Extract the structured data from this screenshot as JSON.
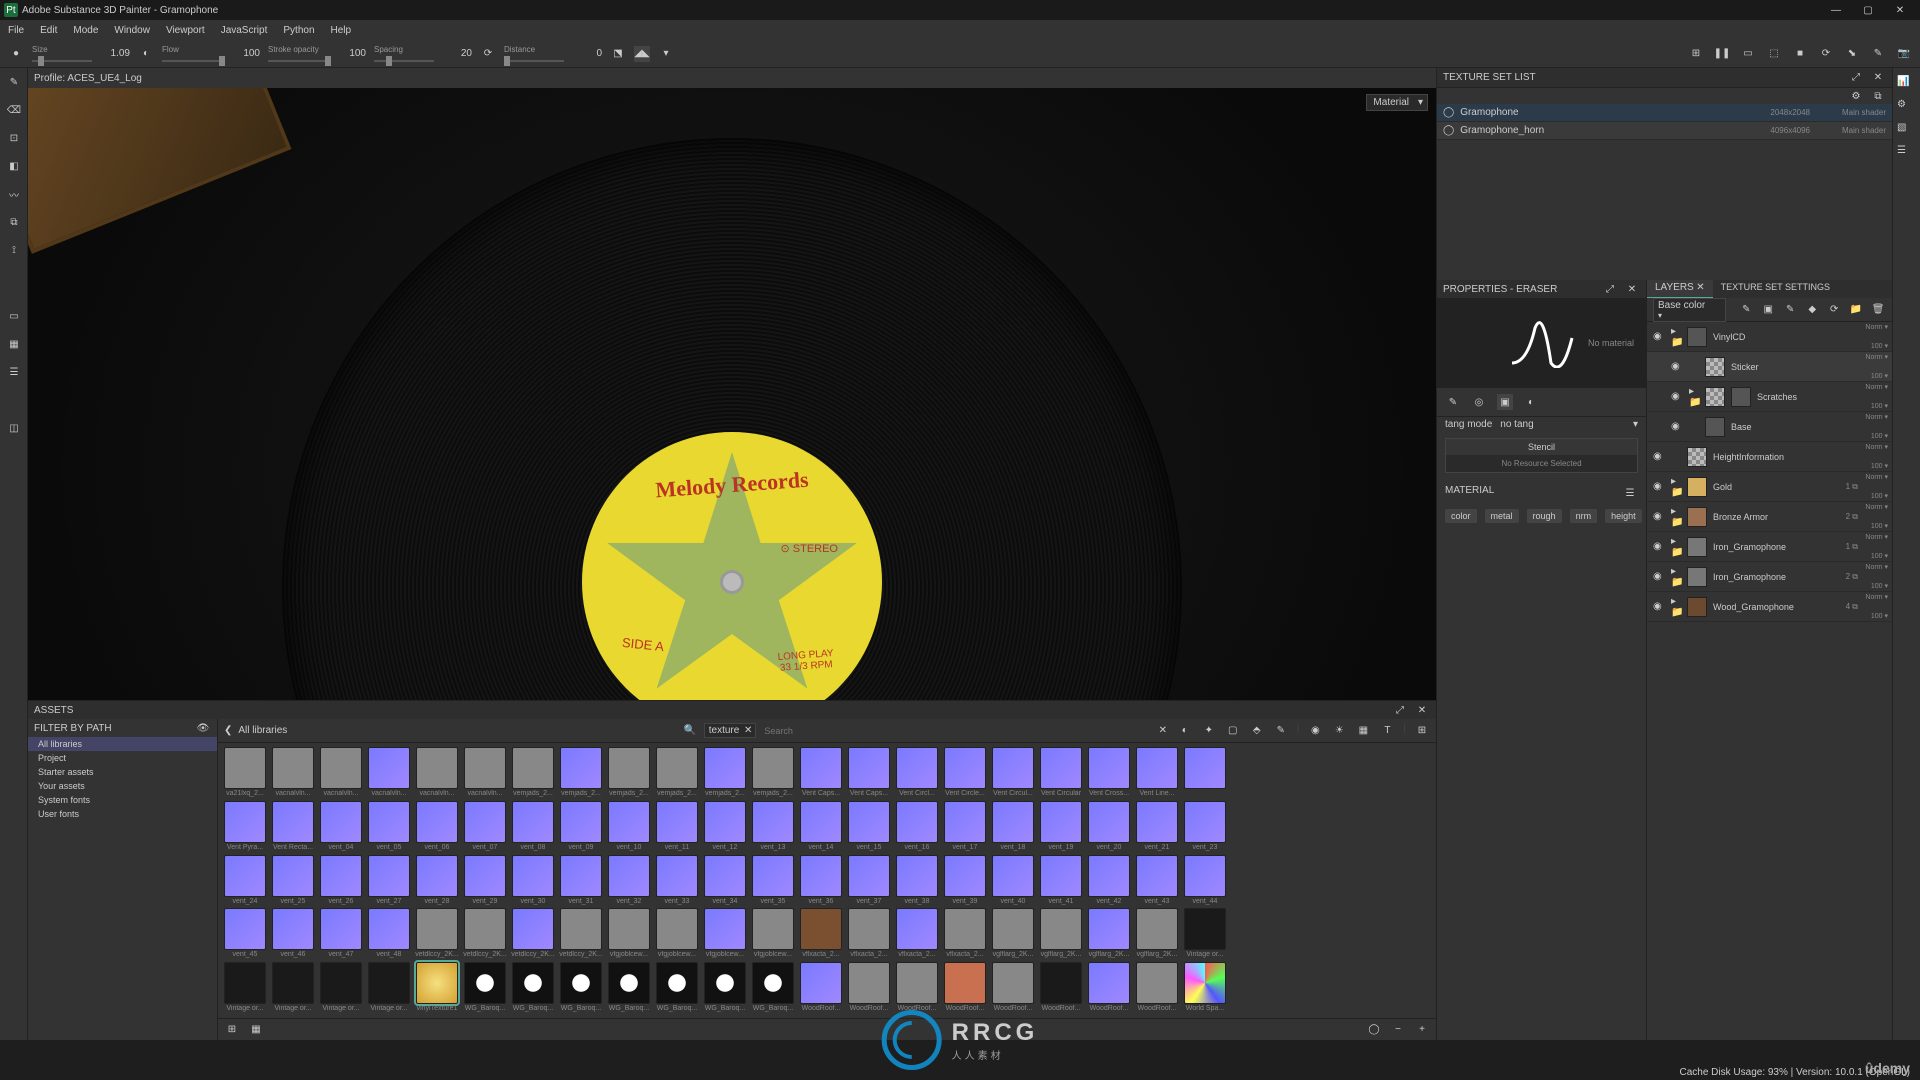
{
  "window": {
    "title": "Adobe Substance 3D Painter - Gramophone"
  },
  "menu": [
    "File",
    "Edit",
    "Mode",
    "Window",
    "Viewport",
    "JavaScript",
    "Python",
    "Help"
  ],
  "toolbar": {
    "size_label": "Size",
    "size_value": "1.09",
    "flow_label": "Flow",
    "flow_value": "100",
    "stroke_label": "Stroke opacity",
    "stroke_value": "100",
    "spacing_label": "Spacing",
    "spacing_value": "20",
    "distance_label": "Distance",
    "distance_value": "0"
  },
  "viewport": {
    "profile": "Profile: ACES_UE4_Log",
    "material_dropdown": "Material",
    "record": {
      "brand": "Melody Records",
      "stereo": "⊙ STEREO",
      "side": "SIDE A",
      "speed": "LONG PLAY\n33 1/3 RPM"
    }
  },
  "texture_set_list": {
    "title": "TEXTURE SET LIST",
    "rows": [
      {
        "name": "Gramophone",
        "res": "2048x2048",
        "shader": "Main shader",
        "selected": true
      },
      {
        "name": "Gramophone_horn",
        "res": "4096x4096",
        "shader": "Main shader",
        "selected": false
      }
    ]
  },
  "properties": {
    "title": "PROPERTIES - ERASER",
    "no_material": "No material",
    "tang_mode_l": "tang mode",
    "tang_mode_v": "no tang",
    "stencil_title": "Stencil",
    "stencil_body": "No Resource Selected",
    "material_title": "MATERIAL",
    "channels": [
      "color",
      "metal",
      "rough",
      "nrm",
      "height"
    ]
  },
  "layers": {
    "tab_layers": "LAYERS",
    "tab_tss": "TEXTURE SET SETTINGS",
    "mode_select": "Base color",
    "items": [
      {
        "name": "VinylCD",
        "thumb": "dark",
        "folder": true,
        "indent": 0,
        "selected": false,
        "blend": "Norm",
        "opacity": "100"
      },
      {
        "name": "Sticker",
        "thumb": "checker",
        "folder": false,
        "indent": 1,
        "selected": true,
        "blend": "Norm",
        "opacity": "100"
      },
      {
        "name": "Scratches",
        "thumb": "checker",
        "mask": true,
        "folder": true,
        "indent": 1,
        "selected": false,
        "blend": "Norm",
        "opacity": "100"
      },
      {
        "name": "Base",
        "thumb": "dark",
        "folder": false,
        "indent": 1,
        "selected": false,
        "blend": "Norm",
        "opacity": "100"
      },
      {
        "name": "HeightInformation",
        "thumb": "checker",
        "folder": false,
        "indent": 0,
        "selected": false,
        "blend": "Norm",
        "opacity": "100"
      },
      {
        "name": "Gold",
        "thumb": "gold",
        "folder": true,
        "indent": 0,
        "selected": false,
        "blend": "Norm",
        "opacity": "100",
        "link": "1"
      },
      {
        "name": "Bronze Armor",
        "thumb": "bronze",
        "folder": true,
        "indent": 0,
        "selected": false,
        "blend": "Norm",
        "opacity": "100",
        "link": "2"
      },
      {
        "name": "Iron_Gramophone",
        "thumb": "iron",
        "folder": true,
        "indent": 0,
        "selected": false,
        "blend": "Norm",
        "opacity": "100",
        "link": "1"
      },
      {
        "name": "Iron_Gramophone",
        "thumb": "iron",
        "folder": true,
        "indent": 0,
        "selected": false,
        "blend": "Norm",
        "opacity": "100",
        "link": "2"
      },
      {
        "name": "Wood_Gramophone",
        "thumb": "wood",
        "folder": true,
        "indent": 0,
        "selected": false,
        "blend": "Norm",
        "opacity": "100",
        "link": "4"
      }
    ]
  },
  "assets": {
    "title": "ASSETS",
    "filter_hdr": "FILTER BY PATH",
    "breadcrumb": "All libraries",
    "search_placeholder": "Search",
    "chip": "texture",
    "libs": [
      {
        "name": "All libraries",
        "selected": true
      },
      {
        "name": "Project"
      },
      {
        "name": "Starter assets"
      },
      {
        "name": "Your assets"
      },
      {
        "name": "System fonts"
      },
      {
        "name": "User fonts"
      }
    ],
    "grid": [
      {
        "t": "gray",
        "l": "va21lxq_2..."
      },
      {
        "t": "gray",
        "l": "vacnalvln..."
      },
      {
        "t": "gray",
        "l": "vacnalvln..."
      },
      {
        "t": "purple",
        "l": "vacnalvln..."
      },
      {
        "t": "gray",
        "l": "vacnalvln..."
      },
      {
        "t": "gray",
        "l": "vacnalvln..."
      },
      {
        "t": "gray",
        "l": "vemjads_2..."
      },
      {
        "t": "purple",
        "l": "vemjads_2..."
      },
      {
        "t": "gray",
        "l": "vemjads_2..."
      },
      {
        "t": "gray",
        "l": "vemjads_2..."
      },
      {
        "t": "purple",
        "l": "vemjads_2..."
      },
      {
        "t": "gray",
        "l": "vemjads_2..."
      },
      {
        "t": "purple",
        "l": "Vent Caps..."
      },
      {
        "t": "purple",
        "l": "Vent Caps..."
      },
      {
        "t": "purple",
        "l": "Vent Circl..."
      },
      {
        "t": "purple",
        "l": "Vent Circle..."
      },
      {
        "t": "purple",
        "l": "Vent Circul..."
      },
      {
        "t": "purple",
        "l": "Vent Circular"
      },
      {
        "t": "purple",
        "l": "Vent Cross..."
      },
      {
        "t": "purple",
        "l": "Vent Line..."
      },
      {
        "t": "purple",
        "l": ""
      },
      {
        "t": "purple",
        "l": "Vent Pyra..."
      },
      {
        "t": "purple",
        "l": "Vent Recta..."
      },
      {
        "t": "purple",
        "l": "vent_04"
      },
      {
        "t": "purple",
        "l": "vent_05"
      },
      {
        "t": "purple",
        "l": "vent_06"
      },
      {
        "t": "purple",
        "l": "vent_07"
      },
      {
        "t": "purple",
        "l": "vent_08"
      },
      {
        "t": "purple",
        "l": "vent_09"
      },
      {
        "t": "purple",
        "l": "vent_10"
      },
      {
        "t": "purple",
        "l": "vent_11"
      },
      {
        "t": "purple",
        "l": "vent_12"
      },
      {
        "t": "purple",
        "l": "vent_13"
      },
      {
        "t": "purple",
        "l": "vent_14"
      },
      {
        "t": "purple",
        "l": "vent_15"
      },
      {
        "t": "purple",
        "l": "vent_16"
      },
      {
        "t": "purple",
        "l": "vent_17"
      },
      {
        "t": "purple",
        "l": "vent_18"
      },
      {
        "t": "purple",
        "l": "vent_19"
      },
      {
        "t": "purple",
        "l": "vent_20"
      },
      {
        "t": "purple",
        "l": "vent_21"
      },
      {
        "t": "purple",
        "l": "vent_23"
      },
      {
        "t": "purple",
        "l": "vent_24"
      },
      {
        "t": "purple",
        "l": "vent_25"
      },
      {
        "t": "purple",
        "l": "vent_26"
      },
      {
        "t": "purple",
        "l": "vent_27"
      },
      {
        "t": "purple",
        "l": "vent_28"
      },
      {
        "t": "purple",
        "l": "vent_29"
      },
      {
        "t": "purple",
        "l": "vent_30"
      },
      {
        "t": "purple",
        "l": "vent_31"
      },
      {
        "t": "purple",
        "l": "vent_32"
      },
      {
        "t": "purple",
        "l": "vent_33"
      },
      {
        "t": "purple",
        "l": "vent_34"
      },
      {
        "t": "purple",
        "l": "vent_35"
      },
      {
        "t": "purple",
        "l": "vent_36"
      },
      {
        "t": "purple",
        "l": "vent_37"
      },
      {
        "t": "purple",
        "l": "vent_38"
      },
      {
        "t": "purple",
        "l": "vent_39"
      },
      {
        "t": "purple",
        "l": "vent_40"
      },
      {
        "t": "purple",
        "l": "vent_41"
      },
      {
        "t": "purple",
        "l": "vent_42"
      },
      {
        "t": "purple",
        "l": "vent_43"
      },
      {
        "t": "purple",
        "l": "vent_44"
      },
      {
        "t": "purple",
        "l": "vent_45"
      },
      {
        "t": "purple",
        "l": "vent_46"
      },
      {
        "t": "purple",
        "l": "vent_47"
      },
      {
        "t": "purple",
        "l": "vent_48"
      },
      {
        "t": "gray",
        "l": "vetdlccy_2K..."
      },
      {
        "t": "gray",
        "l": "vetdlccy_2K..."
      },
      {
        "t": "purple",
        "l": "vetdlccy_2K..."
      },
      {
        "t": "gray",
        "l": "vetdlccy_2K..."
      },
      {
        "t": "gray",
        "l": "vfgjoblcew..."
      },
      {
        "t": "gray",
        "l": "vfgjoblcew..."
      },
      {
        "t": "purple",
        "l": "vfgjoblcew..."
      },
      {
        "t": "gray",
        "l": "vfgjoblcew..."
      },
      {
        "t": "wood",
        "l": "vflxacta_2..."
      },
      {
        "t": "gray",
        "l": "vflxacta_2..."
      },
      {
        "t": "purple",
        "l": "vflxacta_2..."
      },
      {
        "t": "gray",
        "l": "vflxacta_2..."
      },
      {
        "t": "gray",
        "l": "vglflarg_2K..."
      },
      {
        "t": "gray",
        "l": "vglflarg_2K..."
      },
      {
        "t": "purple",
        "l": "vglflarg_2K..."
      },
      {
        "t": "gray",
        "l": "vglflarg_2K..."
      },
      {
        "t": "dark",
        "l": "Vintage or..."
      },
      {
        "t": "dark",
        "l": "Vintage or..."
      },
      {
        "t": "dark",
        "l": "Vintage or..."
      },
      {
        "t": "dark",
        "l": "Vintage or..."
      },
      {
        "t": "dark",
        "l": "Vintage or..."
      },
      {
        "t": "gold",
        "l": "vinylTexture1",
        "sel": true
      },
      {
        "t": "baroque",
        "l": "WG_Baroq..."
      },
      {
        "t": "baroque",
        "l": "WG_Baroq..."
      },
      {
        "t": "baroque",
        "l": "WG_Baroq..."
      },
      {
        "t": "baroque",
        "l": "WG_Baroq..."
      },
      {
        "t": "baroque",
        "l": "WG_Baroq..."
      },
      {
        "t": "baroque",
        "l": "WG_Baroq..."
      },
      {
        "t": "baroque",
        "l": "WG_Baroq..."
      },
      {
        "t": "purple",
        "l": "WoodRoof..."
      },
      {
        "t": "gray",
        "l": "WoodRoof..."
      },
      {
        "t": "gray",
        "l": "WoodRoof..."
      },
      {
        "t": "brick",
        "l": "WoodRoof..."
      },
      {
        "t": "gray",
        "l": "WoodRoof..."
      },
      {
        "t": "dark",
        "l": "WoodRoof..."
      },
      {
        "t": "purple",
        "l": "WoodRoof..."
      },
      {
        "t": "gray",
        "l": "WoodRoof..."
      },
      {
        "t": "colorful",
        "l": "World Spa..."
      }
    ]
  },
  "status": {
    "cache": "Cache Disk Usage:   93%  |  Version: 10.0.1 (OpenGL)"
  },
  "watermark": {
    "main": "RRCG",
    "sub": "人人素材"
  },
  "udemy": "ûdemy"
}
